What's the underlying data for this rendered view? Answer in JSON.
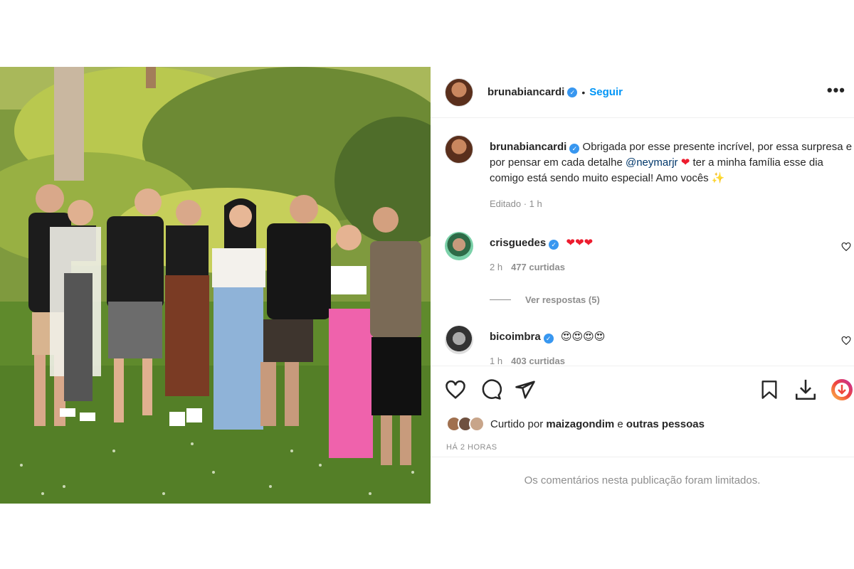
{
  "post": {
    "author": "brunabiancardi",
    "separator": "•",
    "follow_label": "Seguir",
    "more_label": "•••",
    "photo_alt": "Foto",
    "caption": {
      "author": "brunabiancardi",
      "text_before_mention": " Obrigada por esse presente incrível, por essa surpresa e por pensar em cada detalhe ",
      "mention": "@neymarjr",
      "heart": " ❤ ",
      "text_after_mention": "ter a minha família esse dia comigo está sendo muito especial! Amo vocês ✨",
      "meta": "Editado · 1 h"
    },
    "comments": [
      {
        "author": "crisguedes",
        "text": "❤❤❤",
        "time": "2 h",
        "likes": "477 curtidas",
        "replies": "Ver respostas (5)"
      },
      {
        "author": "bicoimbra",
        "text": "😍😍😍😍",
        "time": "1 h",
        "likes": "403 curtidas"
      }
    ],
    "liked_by_prefix": "Curtido por ",
    "liked_by_user": "maizagondim",
    "liked_by_suffix": " e ",
    "liked_by_others": "outras pessoas",
    "time_ago": "HÁ 2 HORAS",
    "comments_limited": "Os comentários nesta publicação foram limitados."
  },
  "colors": {
    "link": "#0095f6",
    "verified": "#3897f0",
    "meta": "#8e8e8e",
    "heart": "#ed1c2e"
  },
  "icons": [
    "verified-icon",
    "more-icon",
    "like-icon",
    "comment-icon",
    "share-icon",
    "save-icon",
    "download-icon",
    "extension-icon"
  ]
}
